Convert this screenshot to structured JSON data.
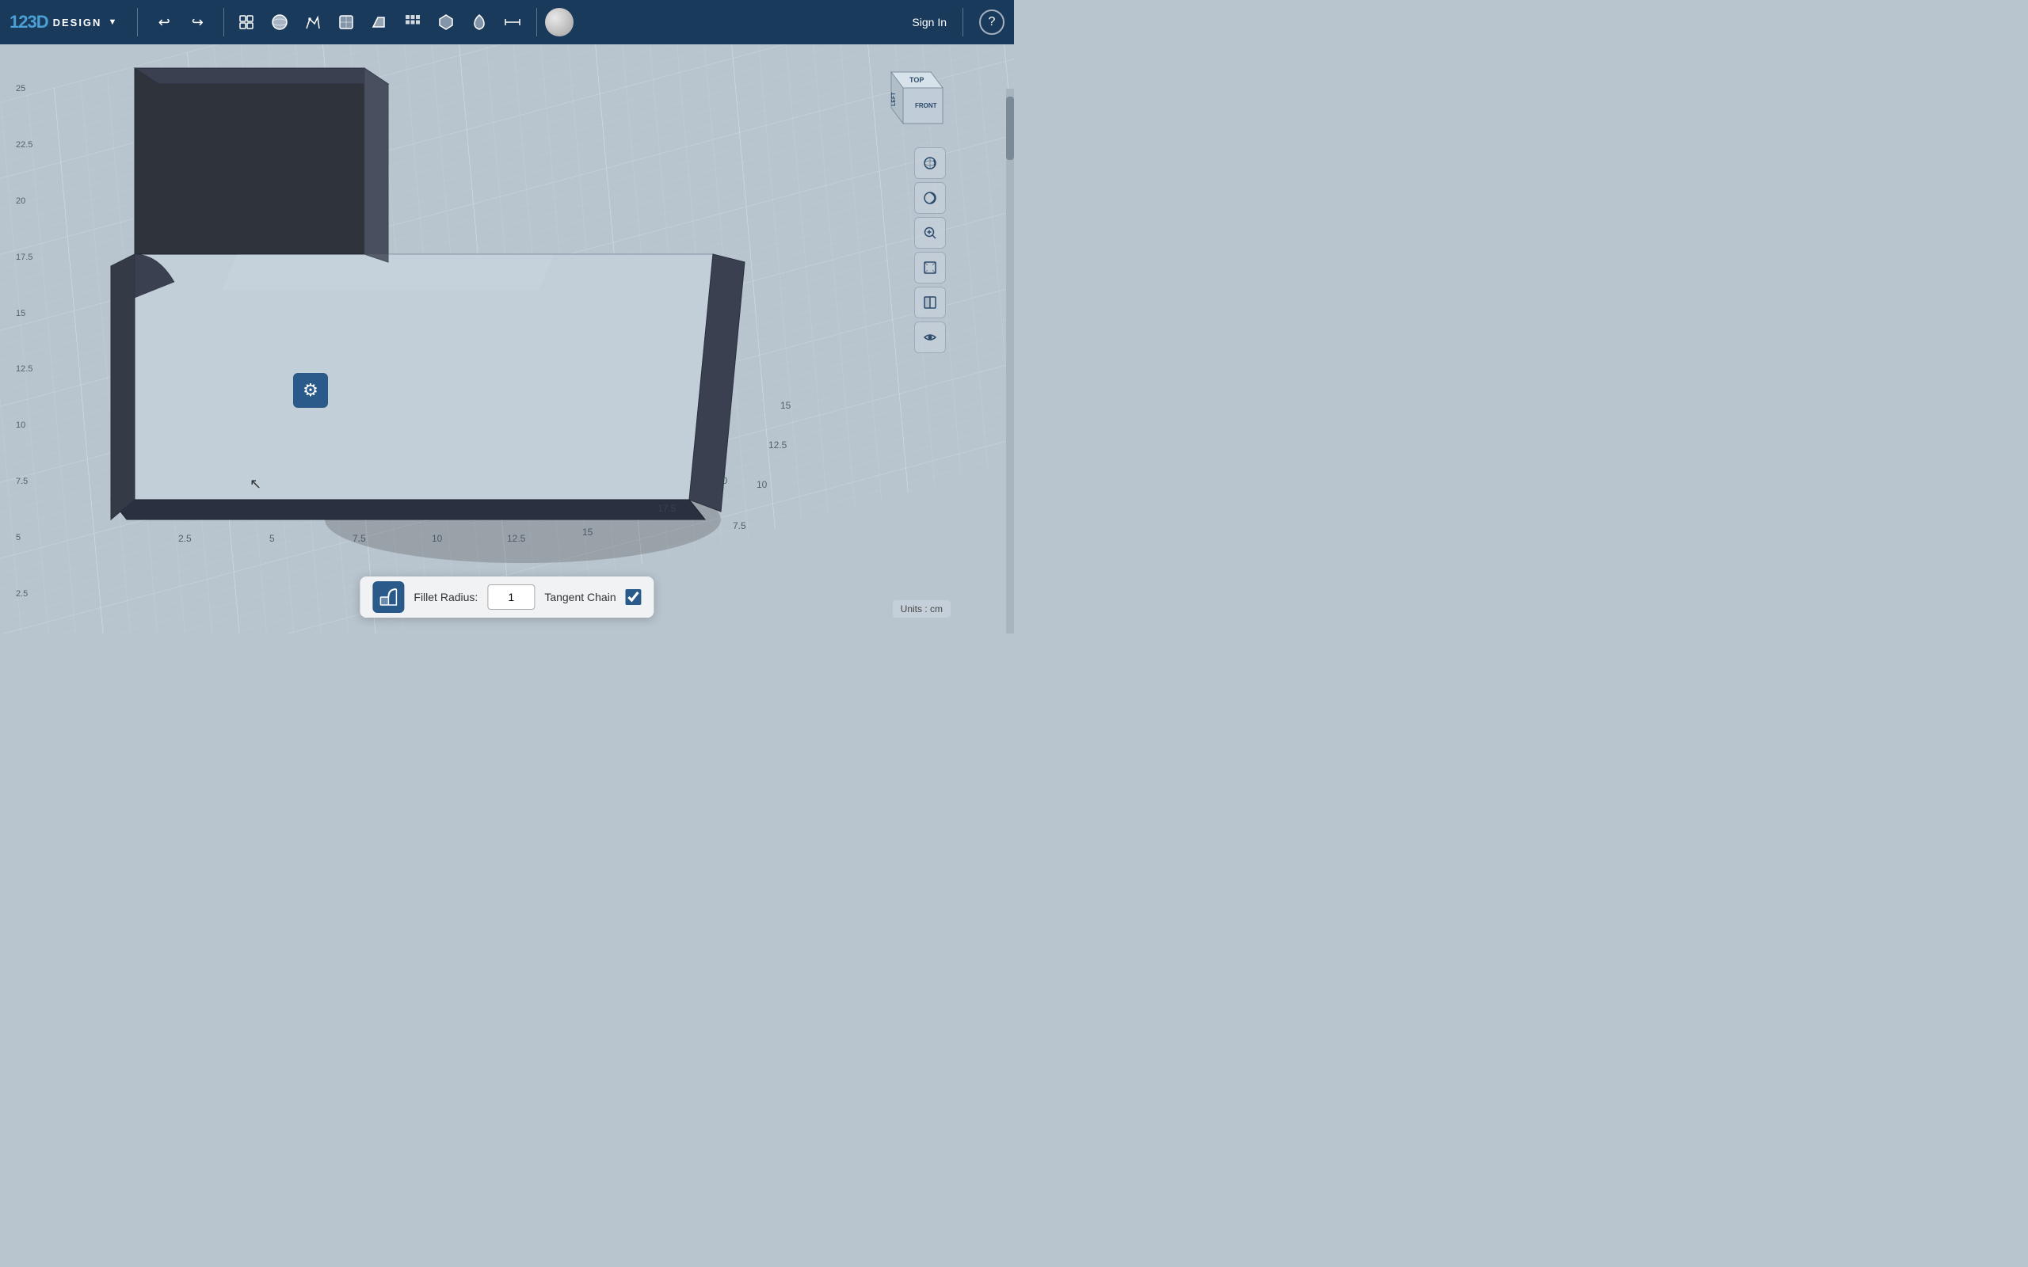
{
  "app": {
    "name": "123D",
    "subtitle": "DESIGN",
    "dropdown_arrow": "▼"
  },
  "navbar": {
    "undo_label": "↩",
    "redo_label": "↪",
    "signin_label": "Sign In",
    "help_label": "?",
    "tools": [
      {
        "name": "snap-grid",
        "icon": "⊞"
      },
      {
        "name": "primitives",
        "icon": "○"
      },
      {
        "name": "sketch",
        "icon": "✏"
      },
      {
        "name": "construct",
        "icon": "⬡"
      },
      {
        "name": "modify",
        "icon": "⬛"
      },
      {
        "name": "pattern",
        "icon": "⊞"
      },
      {
        "name": "group",
        "icon": "❖"
      },
      {
        "name": "snap",
        "icon": "↩"
      },
      {
        "name": "measure",
        "icon": "↔"
      },
      {
        "name": "material",
        "icon": "●"
      }
    ]
  },
  "viewport": {
    "background_color": "#b8c4ce"
  },
  "ruler": {
    "left_values": [
      "25",
      "22.5",
      "20",
      "17.5",
      "15",
      "12.5",
      "10",
      "7.5",
      "5",
      "2.5"
    ],
    "bottom_values": [
      "2.5",
      "5",
      "7.5",
      "10",
      "12.5",
      "15",
      "17.5",
      "20"
    ]
  },
  "nav_cube": {
    "top_label": "TOP",
    "front_label": "FRONT",
    "left_label": "LEFT"
  },
  "view_controls": [
    {
      "name": "orbit",
      "icon": "⊕"
    },
    {
      "name": "zoom-in",
      "icon": "🔍"
    },
    {
      "name": "fit",
      "icon": "⊡"
    },
    {
      "name": "section",
      "icon": "⊘"
    },
    {
      "name": "visibility",
      "icon": "👁"
    }
  ],
  "bottom_toolbar": {
    "tool_icon": "⬡",
    "fillet_radius_label": "Fillet Radius:",
    "fillet_radius_value": "1",
    "tangent_chain_label": "Tangent Chain",
    "tangent_chain_checked": true
  },
  "units": {
    "label": "Units : cm"
  },
  "gear_button": {
    "icon": "⚙"
  }
}
